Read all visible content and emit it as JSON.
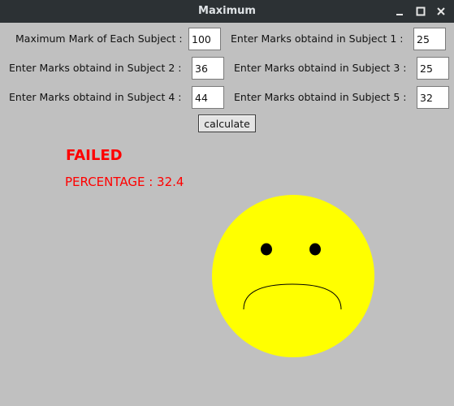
{
  "window": {
    "title": "Maximum"
  },
  "form": {
    "max_mark_label": "Maximum Mark of Each Subject :",
    "max_mark_value": "100",
    "subject1_label": "Enter Marks obtaind in Subject 1 :",
    "subject1_value": "25",
    "subject2_label": "Enter Marks obtaind in Subject 2 :",
    "subject2_value": "36",
    "subject3_label": "Enter Marks obtaind in Subject 3 :",
    "subject3_value": "25",
    "subject4_label": "Enter Marks obtaind in Subject 4 :",
    "subject4_value": "44",
    "subject5_label": "Enter Marks obtaind in Subject 5 :",
    "subject5_value": "32",
    "calculate_label": "calculate"
  },
  "result": {
    "status": "FAILED",
    "percentage": "PERCENTAGE : 32.4",
    "status_color": "#ff0000",
    "face": "sad-face",
    "face_color": "#ffff00"
  },
  "colors": {
    "background": "#c0c0c0",
    "titlebar": "#2c3134"
  }
}
